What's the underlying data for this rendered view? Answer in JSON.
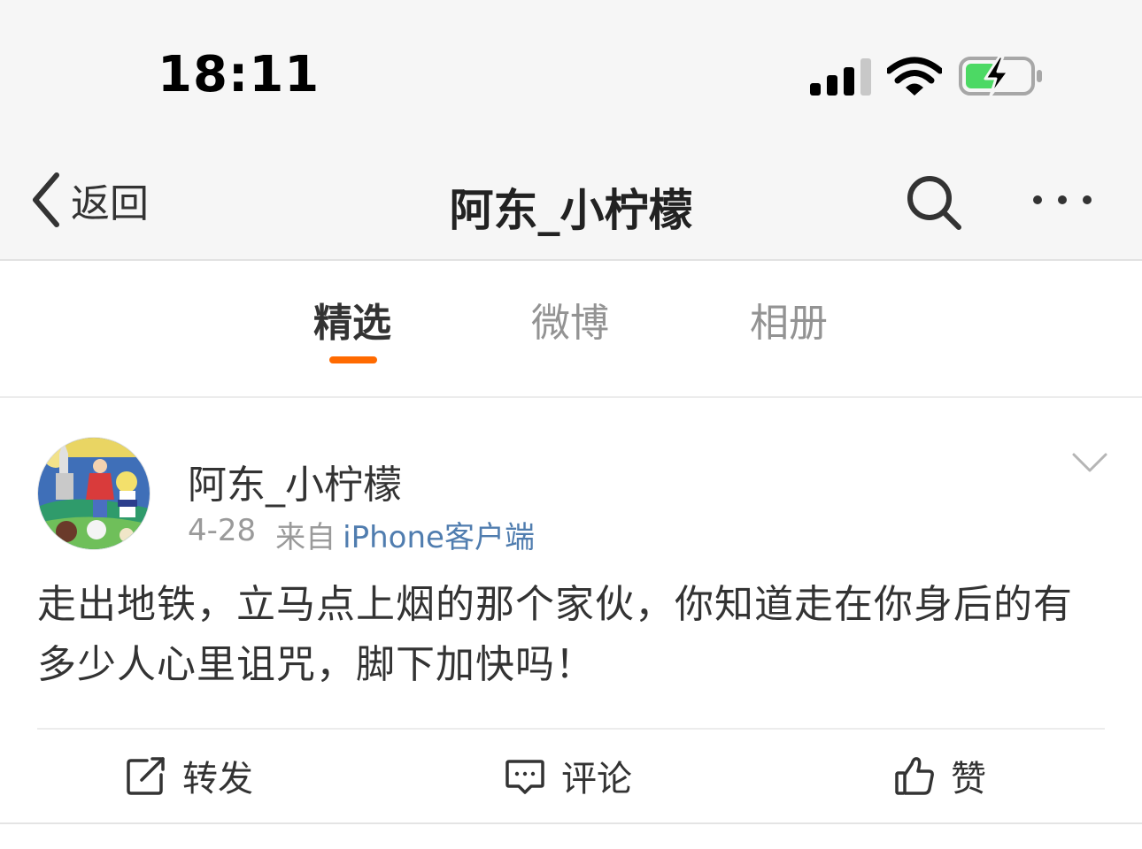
{
  "status_bar": {
    "time": "18:11",
    "battery_color": "#4cd964"
  },
  "nav": {
    "back_label": "返回",
    "title": "阿东_小柠檬"
  },
  "tabs": [
    {
      "label": "精选",
      "active": true
    },
    {
      "label": "微博",
      "active": false
    },
    {
      "label": "相册",
      "active": false
    }
  ],
  "accent_color": "#ff6a00",
  "post": {
    "author": "阿东_小柠檬",
    "date": "4-28",
    "from_label": "来自",
    "source": "iPhone客户端",
    "text": "走出地铁，立马点上烟的那个家伙，你知道走在你身后的有多少人心里诅咒，脚下加快吗！",
    "actions": {
      "repost": "转发",
      "comment": "评论",
      "like": "赞"
    }
  }
}
